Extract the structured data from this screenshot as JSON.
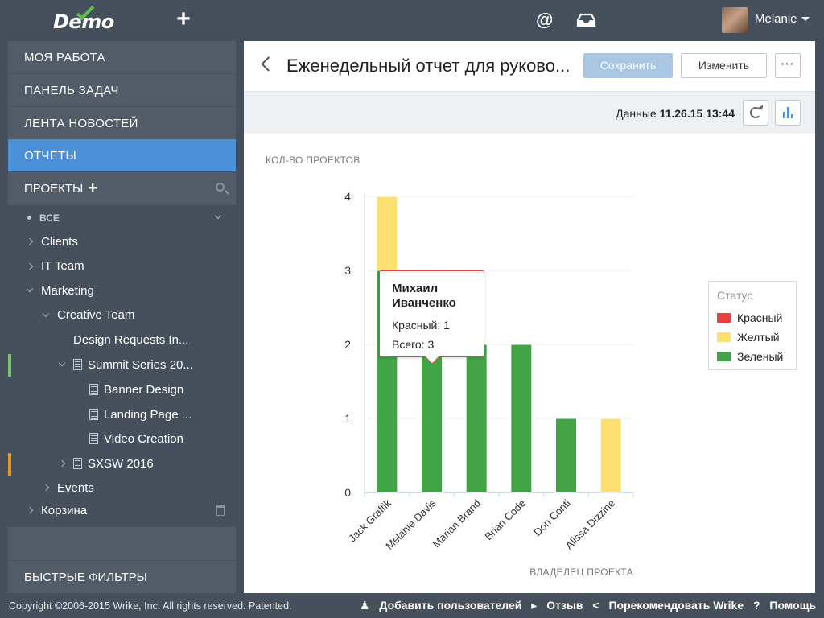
{
  "header": {
    "logo": "Demo",
    "user_name": "Melanie"
  },
  "sidebar": {
    "nav": [
      {
        "label": "МОЯ РАБОТА"
      },
      {
        "label": "ПАНЕЛЬ ЗАДАЧ"
      },
      {
        "label": "ЛЕНТА НОВОСТЕЙ"
      },
      {
        "label": "ОТЧЕТЫ",
        "active": true
      }
    ],
    "projects_label": "ПРОЕКТЫ",
    "all_label": "ВСЕ",
    "tree": [
      {
        "label": "Clients"
      },
      {
        "label": "IT Team"
      },
      {
        "label": "Marketing"
      },
      {
        "label": "Creative Team"
      },
      {
        "label": "Design Requests In..."
      },
      {
        "label": "Summit Series 20..."
      },
      {
        "label": "Banner Design"
      },
      {
        "label": "Landing Page ..."
      },
      {
        "label": "Video Creation"
      },
      {
        "label": "SXSW 2016"
      },
      {
        "label": "Events"
      },
      {
        "label": "Корзина"
      }
    ],
    "quick_filters": "БЫСТРЫЕ ФИЛЬТРЫ",
    "marker_colors": {
      "summit": "#7cc26b",
      "sxsw": "#f0921e"
    }
  },
  "report": {
    "title": "Еженедельный отчет для руково...",
    "save_label": "Сохранить",
    "edit_label": "Изменить",
    "more_label": "···",
    "data_prefix": "Данные",
    "data_timestamp": "11.26.15 13:44"
  },
  "tooltip": {
    "name_line1": "Михаил",
    "name_line2": "Иванченко",
    "red_line": "Красный: 1",
    "total_line": "Всего: 3"
  },
  "legend": {
    "title": "Статус",
    "items": [
      {
        "label": "Красный",
        "color": "#e8413e"
      },
      {
        "label": "Желтый",
        "color": "#fde072"
      },
      {
        "label": "Зеленый",
        "color": "#42a447"
      }
    ]
  },
  "chart_data": {
    "type": "bar",
    "stacked": true,
    "ylabel": "КОЛ-ВО ПРОЕКТОВ",
    "xlabel": "ВЛАДЕЛЕЦ ПРОЕКТА",
    "ylim": [
      0,
      4
    ],
    "yticks": [
      0,
      1,
      2,
      3,
      4
    ],
    "categories": [
      "Jack Graffik",
      "Melanie Davis",
      "Marian Brand",
      "Brian Code",
      "Don Conti",
      "Alissa Dizzine"
    ],
    "series": [
      {
        "name": "Зеленый",
        "color": "#42a447",
        "values": [
          3,
          2,
          2,
          2,
          1,
          0
        ]
      },
      {
        "name": "Красный",
        "color": "#ff5149",
        "values": [
          0,
          1,
          0,
          0,
          0,
          0
        ]
      },
      {
        "name": "Желтый",
        "color": "#fde072",
        "values": [
          1,
          0,
          0,
          0,
          0,
          1
        ]
      }
    ]
  },
  "footer": {
    "copyright": "Copyright ©2006-2015 Wrike, Inc. All rights reserved. Patented.",
    "add_users": "Добавить пользователей",
    "feedback": "Отзыв",
    "recommend": "Порекомендовать Wrike",
    "help": "Помощь"
  }
}
